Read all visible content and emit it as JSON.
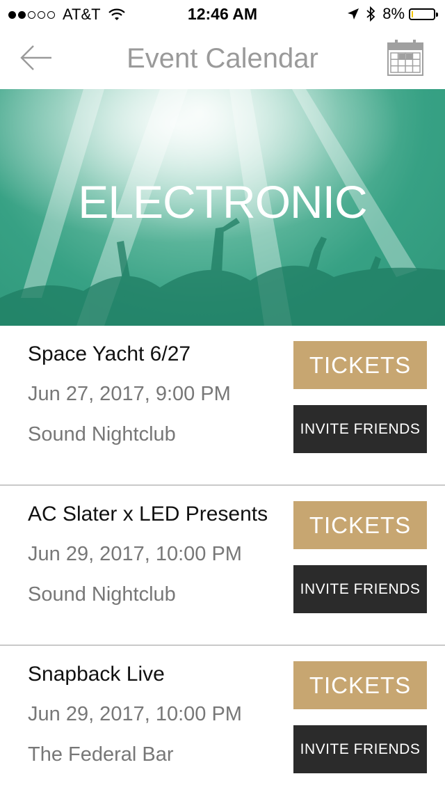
{
  "status_bar": {
    "carrier": "AT&T",
    "time": "12:46 AM",
    "battery": "8%",
    "battery_level": 0.08,
    "battery_color": "#f3c400"
  },
  "nav": {
    "title": "Event Calendar",
    "back_icon": "back-arrow-icon",
    "calendar_icon": "calendar-icon"
  },
  "banner": {
    "title": "ELECTRONIC",
    "accent_color": "#3aa585"
  },
  "events": [
    {
      "name": "Space Yacht 6/27",
      "date": "Jun 27, 2017, 9:00 PM",
      "venue": "Sound Nightclub",
      "tickets_label": "TICKETS",
      "invite_label": "INVITE FRIENDS"
    },
    {
      "name": "AC Slater x LED Presents",
      "date": "Jun 29, 2017, 10:00 PM",
      "venue": "Sound Nightclub",
      "tickets_label": "TICKETS",
      "invite_label": "INVITE FRIENDS"
    },
    {
      "name": "Snapback Live",
      "date": "Jun 29, 2017, 10:00 PM",
      "venue": "The Federal Bar",
      "tickets_label": "TICKETS",
      "invite_label": "INVITE FRIENDS"
    }
  ],
  "colors": {
    "tickets_button": "#c7a671",
    "invite_button": "#2b2b2b"
  }
}
